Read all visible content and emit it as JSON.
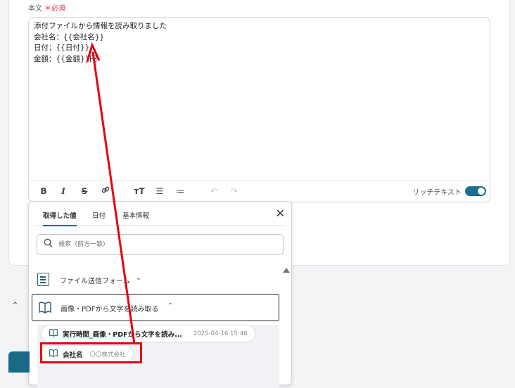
{
  "field": {
    "label": "本文",
    "required_label": "＊必須",
    "lines": [
      "添付ファイルから情報を読み取りました",
      "会社名：{{会社名}}",
      "日付：{{日付}}",
      "金額：{{金額}}円"
    ]
  },
  "toolbar": {
    "icons": [
      "bold-icon",
      "italic-icon",
      "strikethrough-icon",
      "link-icon",
      "text-size-icon",
      "bullet-list-icon",
      "numbered-list-icon",
      "undo-icon",
      "redo-icon"
    ],
    "rich_text_label": "リッチテキスト",
    "rich_text_enabled": true
  },
  "popup": {
    "tabs": [
      "取得した値",
      "日付",
      "基本情報"
    ],
    "active_tab": "取得した値",
    "search_placeholder": "検索（前方一致）",
    "groups": [
      {
        "label": "ファイル送信フォーム",
        "expanded": false
      },
      {
        "label": "画像・PDFから文字を読み取る",
        "expanded": true
      }
    ],
    "items": [
      {
        "name": "実行時間_画像・PDFから文字を読み...",
        "value": "2025-04-16 15:46"
      },
      {
        "name": "会社名",
        "value": "〇〇株式会社"
      }
    ]
  },
  "colors": {
    "accent": "#1a6e8e",
    "required": "#e0294f",
    "annotation": "#e60012"
  }
}
